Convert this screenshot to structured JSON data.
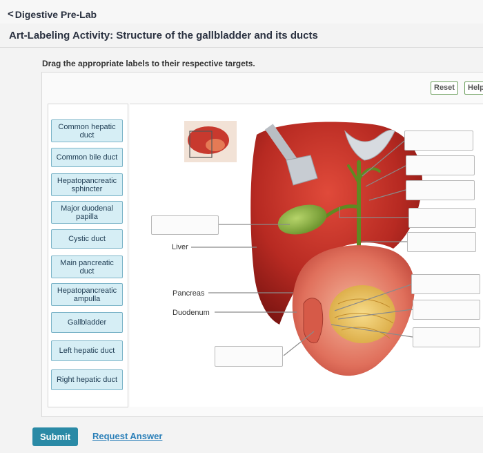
{
  "nav": {
    "back_glyph": "<",
    "back_label": "Digestive Pre-Lab"
  },
  "header": {
    "title": "Art-Labeling Activity: Structure of the gallbladder and its ducts"
  },
  "instruction": "Drag the appropriate labels to their respective targets.",
  "toolbar": {
    "reset_label": "Reset",
    "help_label": "Help"
  },
  "labels": [
    "Common hepatic duct",
    "Common bile duct",
    "Hepatopancreatic sphincter",
    "Major duodenal papilla",
    "Cystic duct",
    "Main pancreatic duct",
    "Hepatopancreatic ampulla",
    "Gallbladder",
    "Left hepatic duct",
    "Right hepatic duct"
  ],
  "diagram_labels": {
    "liver": "Liver",
    "pancreas": "Pancreas",
    "duodenum": "Duodenum"
  },
  "footer": {
    "submit_label": "Submit",
    "request_answer_label": "Request Answer"
  },
  "colors": {
    "accent": "#2a8aa6",
    "label_bg": "#d6eef5",
    "link": "#2a7fb8"
  }
}
